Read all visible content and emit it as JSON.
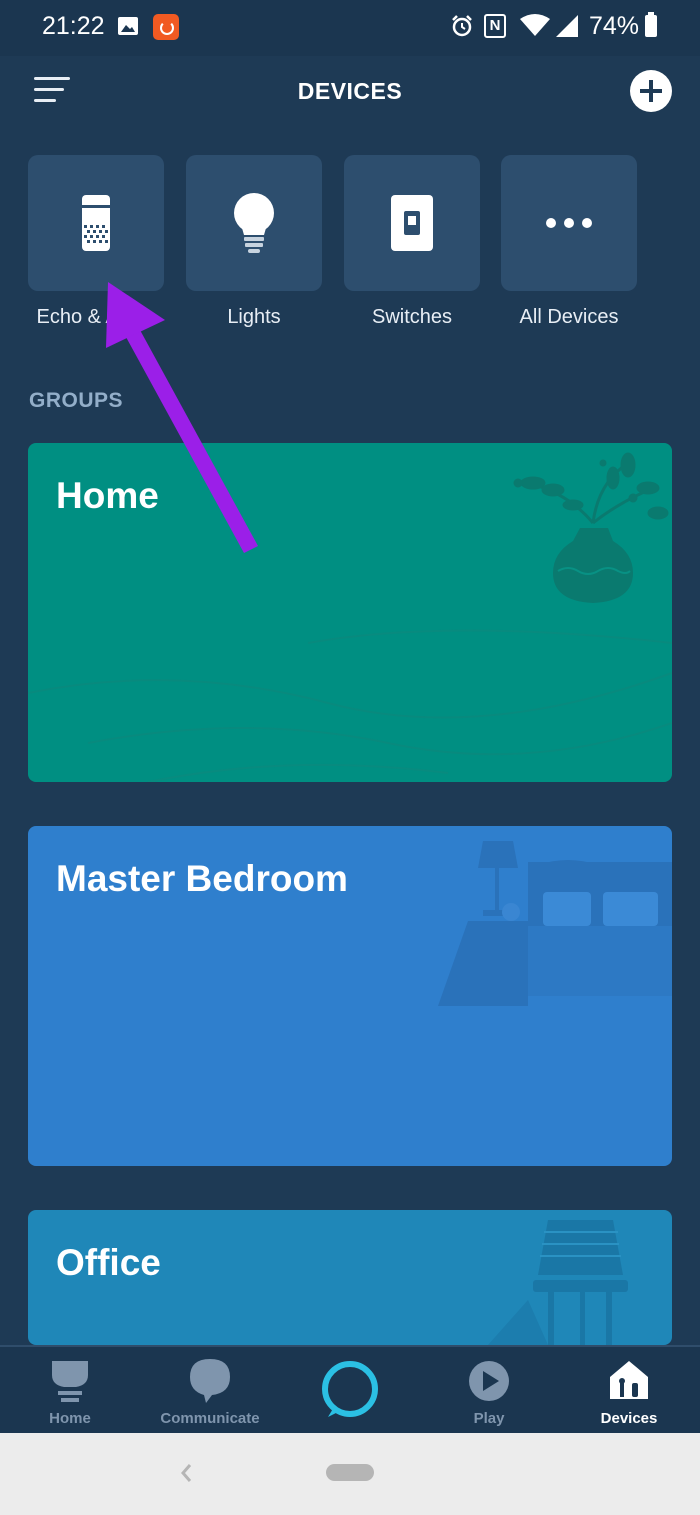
{
  "status_bar": {
    "time": "21:22",
    "battery_percent": "74%",
    "icons": [
      "image-icon",
      "app-notification-icon",
      "alarm-icon",
      "nfc-icon",
      "wifi-icon",
      "signal-icon",
      "battery-icon"
    ]
  },
  "header": {
    "title": "DEVICES",
    "menu_icon": "hamburger-menu-icon",
    "add_icon": "plus-circle-icon"
  },
  "categories": [
    {
      "label": "Echo & Alexa",
      "icon": "echo-speaker-icon"
    },
    {
      "label": "Lights",
      "icon": "light-bulb-icon"
    },
    {
      "label": "Switches",
      "icon": "light-switch-icon"
    },
    {
      "label": "All Devices",
      "icon": "more-dots-icon"
    }
  ],
  "groups": {
    "heading": "GROUPS",
    "items": [
      {
        "name": "Home",
        "color": "#008f82"
      },
      {
        "name": "Master Bedroom",
        "color": "#2f7fcd"
      },
      {
        "name": "Office",
        "color": "#1f87b8"
      }
    ]
  },
  "bottom_nav": {
    "items": [
      {
        "label": "Home",
        "icon": "home-feed-icon",
        "active": false
      },
      {
        "label": "Communicate",
        "icon": "chat-bubble-icon",
        "active": false
      },
      {
        "label": "",
        "icon": "alexa-ring-icon",
        "active": false
      },
      {
        "label": "Play",
        "icon": "play-icon",
        "active": false
      },
      {
        "label": "Devices",
        "icon": "devices-house-icon",
        "active": true
      }
    ]
  },
  "colors": {
    "background": "#1e3a55",
    "tile": "#2d4e6e",
    "alexa_accent": "#2bc0e4",
    "annotation_arrow": "#9b1fe8"
  }
}
